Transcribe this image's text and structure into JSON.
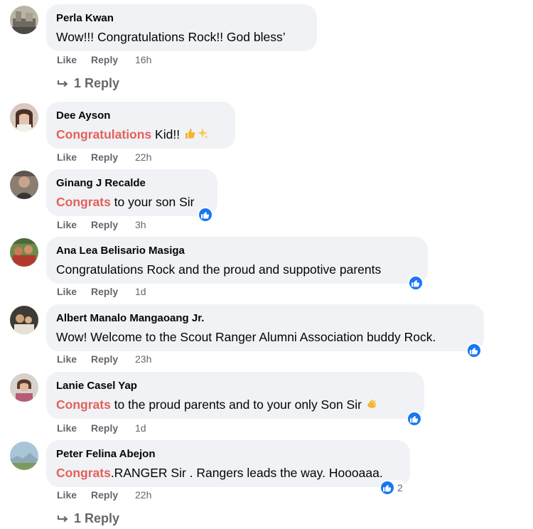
{
  "actions": {
    "like": "Like",
    "reply": "Reply"
  },
  "icons": {
    "like_reaction": "thumbs-up-icon",
    "reply_arrow": "reply-arrow-icon"
  },
  "colors": {
    "bubble": "#f0f2f5",
    "highlight": "#e4605a",
    "like_blue": "#1877f2",
    "muted": "#65676b"
  },
  "comments": [
    {
      "author": "Perla Kwan",
      "text": "Wow!!! Congratulations Rock!! God bless’",
      "time": "16h",
      "replies": "1 Reply"
    },
    {
      "author": "Dee Ayson",
      "highlight": "Congratulations",
      "text": " Kid!!",
      "time": "22h"
    },
    {
      "author": "Ginang J Recalde",
      "highlight": "Congrats",
      "text": " to your son Sir",
      "time": "3h"
    },
    {
      "author": "Ana Lea Belisario Masiga",
      "text": "Congratulations Rock and the proud and suppotive parents",
      "time": "1d"
    },
    {
      "author": "Albert Manalo Mangaoang Jr.",
      "text": "Wow! Welcome to the Scout Ranger Alumni Association buddy Rock.",
      "time": "23h"
    },
    {
      "author": "Lanie Casel Yap",
      "highlight": "Congrats",
      "text": " to the proud parents and to your only Son Sir",
      "time": "1d"
    },
    {
      "author": "Peter Felina Abejon",
      "highlight": "Congrats",
      "text": ".RANGER Sir . Rangers leads the way. Hoooaaa.",
      "time": "22h",
      "reaction_count": "2",
      "replies": "1 Reply"
    }
  ]
}
